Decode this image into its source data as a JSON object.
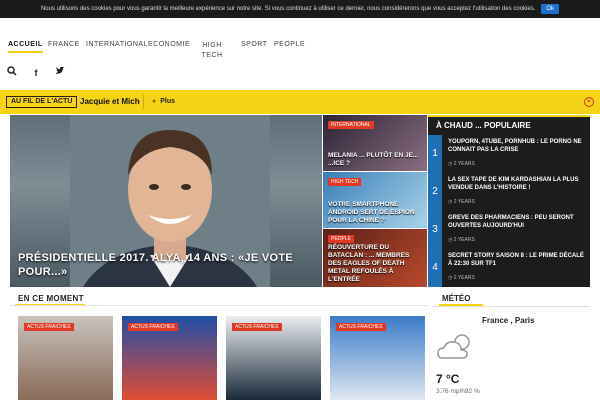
{
  "cookie": {
    "text": "Nous utilisons des cookies pour vous garantir la meilleure expérience sur notre site. Si vous continuez à utiliser ce dernier, nous considérerons que vous acceptez l'utilisation des cookies.",
    "ok_label": "Ok"
  },
  "nav": {
    "items": [
      {
        "label": "ACCUEIL"
      },
      {
        "label": "FRANCE"
      },
      {
        "label": "INTERNATIONAL"
      },
      {
        "label": "ECONOMIE"
      },
      {
        "label": "HIGH TECH"
      },
      {
        "label": "SPORT"
      },
      {
        "label": "PEOPLE"
      }
    ]
  },
  "tools": {
    "search_icon": "search-icon",
    "facebook_icon": "facebook-icon",
    "twitter_icon": "twitter-icon"
  },
  "ticker": {
    "label": "AU FIL DE L'ACTU",
    "text": "Jacquie et Mich",
    "plus": "Plus"
  },
  "hero": {
    "title": "PRÉSIDENTIELLE 2017. ALYA, 14 ANS : «JE VOTE POUR...»"
  },
  "mid_cards": [
    {
      "tag": "INTERNATIONAL",
      "title": "MELANIA ... PLUTÔT EN JE... ...ICE ?"
    },
    {
      "tag": "HIGH TECH",
      "title": "VOTRE SMARTPHONE ANDROID SERT DE ESPION POUR LA CHINE ?"
    },
    {
      "tag": "PEOPLE",
      "title": "RÉOUVERTURE DU BATACLAN : ... MEMBRES DES EAGLES OF DEATH METAL REFOULÉS À L'ENTRÉE"
    }
  ],
  "popular": {
    "heading": "À CHAUD ... POPULAIRE",
    "items": [
      {
        "num": "1",
        "title": "YOUPORN, 4TUBE, PORNHUB : LE PORNO NE CONNAIT PAS LA CRISE",
        "meta": "2 YEARS"
      },
      {
        "num": "2",
        "title": "LA SEX TAPE DE KIM KARDASHIAN LA PLUS VENDUE DANS L'HISTOIRE !",
        "meta": "2 YEARS"
      },
      {
        "num": "3",
        "title": "GREVE DES PHARMACIENS : PEU SERONT OUVERTES AUJOURD'HUI",
        "meta": "2 YEARS"
      },
      {
        "num": "4",
        "title": "SECRET STORY SAISON 8 : LE PRIME DÉCALÉ À 22:30 SUR TF1",
        "meta": "2 YEARS"
      }
    ]
  },
  "section": {
    "title": "EN CE MOMENT",
    "tags": [
      "ACTUS FRAICHES",
      "ACTUS FRAICHES",
      "ACTUS FRAICHES",
      "ACTUS FRAICHES"
    ]
  },
  "meteo": {
    "title": "MÉTÉO",
    "city": "France , Paris",
    "temp": "7 °C",
    "wind": "3.76 mp/h92 %",
    "icon": "cloud-sun-icon"
  },
  "colors": {
    "accent": "#f5d416",
    "tag": "#e03a25",
    "popular_num": "#1e6fb3"
  }
}
